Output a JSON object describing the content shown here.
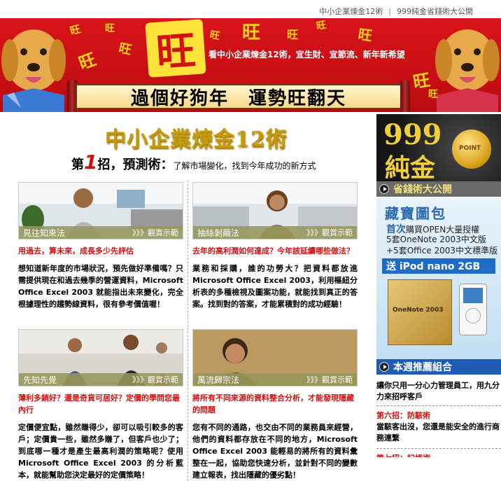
{
  "topnav": {
    "link1": "中小企業煉金12術",
    "separator": "|",
    "link2": "999純金省錢術大公開"
  },
  "banner": {
    "big_char": "旺",
    "small_char": "旺",
    "tagline": "看中小企業煉金12術，宜生財、宜節流、新年新希望",
    "scroll_text": "過個好狗年　運勢旺翻天"
  },
  "main": {
    "title": "中小企業煉金12術",
    "subtitle_lead_prefix": "第",
    "subtitle_number": "1",
    "subtitle_lead_suffix": "招，預測術：",
    "subtitle_desc": "了解市場變化，找到今年成功的新方式"
  },
  "articles": [
    {
      "tag": "見往知來法",
      "demo": "》》》觀賞示範",
      "headline": "用過去，算未來，成長多少先評估",
      "body": "想知道新年度的市場狀況，預先做好準備嗎？只需提供現在和過去幾季的營運資料，Microsoft Office Excel 2003 就能指出未來變化，完全根據理性的趨勢線資料，很有參考價值喔！"
    },
    {
      "tag": "抽絲剝繭法",
      "demo": "》》》觀賞示範",
      "headline": "去年的高利潤如何達成？今年該延續哪些做法？",
      "body": "業務和採購，誰的功勞大？把資料都放進Microsoft Office Excel 2003，利用樞紐分析表的多種檢視及圖案功能，就能找到真正的答案。找到對的答案，才能累積對的成功經驗！"
    },
    {
      "tag": "先知先覺",
      "demo": "》》》觀賞示範",
      "headline": "薄利多銷好？還是奇貨可居好？定價的學問您最內行",
      "body": "定價便宜點，雖然賺得少，卻可以吸引較多的客戶；定價貴一些，雖然多賺了，但客戶也少了；到底哪一種才是產生最高利潤的策略呢？使用 Microsoft Office Excel 2003 的分析藍本，就能幫助您決定最好的定價策略！"
    },
    {
      "tag": "萬流歸宗法",
      "demo": "》》》觀賞示範",
      "headline": "將所有不同來源的資料整合分析，才能發現隱藏的問題",
      "body": "您有不同的通路，也交由不同的業務員來經營，他們的資料都存放在不同的地方，Microsoft Office Excel 2003 能輕易的將所有的資料彙整在一起，協助您快速分析，並針對不同的變數建立報表，找出隱藏的優劣點！"
    }
  ],
  "sidebar": {
    "ad_gold": {
      "line1": "999",
      "line2": "純金",
      "coin_text": "POINT",
      "bar_label": "省錢術大公開"
    },
    "ad_blue": {
      "title": "藏寶圖包",
      "line1_bold": "首次",
      "line1_rest": "購買OPEN大量授權",
      "line2": "5套OneNote 2003中文版",
      "line3": "+5套Office 2003中文標準版",
      "ipod": "送 iPod nano 2GB",
      "box_label": "OneNote 2003",
      "bar_label": "本週推薦組合"
    },
    "list": {
      "fragment": "讓你只用一分心力管理員工，用九分力來招呼客戶",
      "item6_title": "第六招：防駭術",
      "item6_body": "當駭客出沒，您還是能安全的進行商務連繫",
      "item7_title": "第七招：記帳術"
    }
  },
  "colors": {
    "banner_red": "#c80f14",
    "gold": "#c69a0a",
    "headline_red": "#d41010",
    "ad_blue": "#1f5db5"
  }
}
